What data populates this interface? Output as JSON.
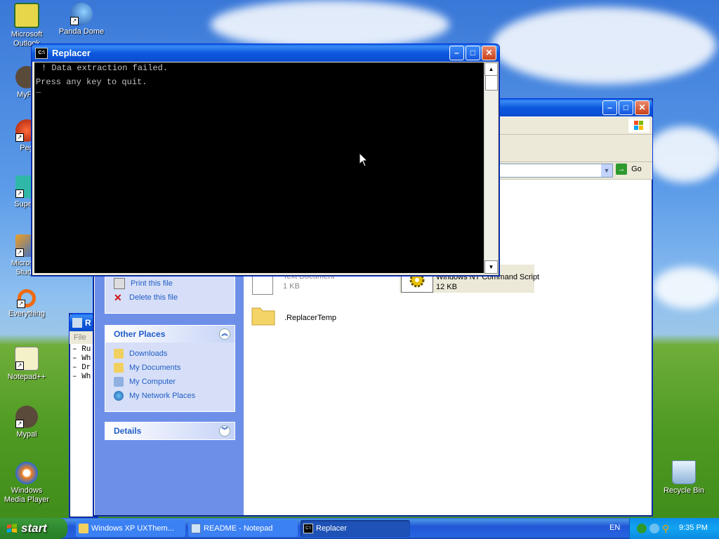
{
  "desktop": {
    "icons": [
      {
        "label": "Microsoft Outlook",
        "name": "outlook"
      },
      {
        "label": "Panda Dome",
        "name": "panda-dome"
      },
      {
        "label": "MyPa",
        "name": "mypal-partial"
      },
      {
        "label": "Peg",
        "name": "peg-partial"
      },
      {
        "label": "Supern",
        "name": "supern-partial"
      },
      {
        "label": "Microsoft Studio",
        "name": "ms-studio-partial"
      },
      {
        "label": "Everything",
        "name": "everything"
      },
      {
        "label": "Notepad++",
        "name": "notepadpp"
      },
      {
        "label": "Mypal",
        "name": "mypal"
      },
      {
        "label": "Windows Media Player",
        "name": "wmp"
      },
      {
        "label": "Recycle Bin",
        "name": "recycle-bin"
      }
    ]
  },
  "console_window": {
    "title": "Replacer",
    "title_icon": "C:\\",
    "lines": [
      "! Data extraction failed.",
      "Press any key to quit.",
      "_"
    ]
  },
  "explorer": {
    "go_label": "Go",
    "file_tasks": [
      {
        "label": "Print this file",
        "icon": "printer-icon"
      },
      {
        "label": "Delete this file",
        "icon": "delete-x-icon"
      }
    ],
    "other_places": {
      "title": "Other Places",
      "items": [
        "Downloads",
        "My Documents",
        "My Computer",
        "My Network Places"
      ]
    },
    "details": {
      "title": "Details"
    },
    "files": [
      {
        "name": "",
        "type": "Text Document",
        "size": "1 KB"
      },
      {
        "name": "",
        "type": "Windows NT Command Script",
        "size": "12 KB"
      },
      {
        "name": ".ReplacerTemp",
        "type": "",
        "size": ""
      }
    ]
  },
  "notepad_partial": {
    "title": "R",
    "menu": "File",
    "lines": [
      "Ru",
      "Wh",
      "Dr",
      "Wh"
    ]
  },
  "taskbar": {
    "start_label": "start",
    "items": [
      {
        "label": "Windows XP UXThem...",
        "icon": "folder-icon"
      },
      {
        "label": "README - Notepad",
        "icon": "notepad-icon"
      },
      {
        "label": "Replacer",
        "icon": "console-icon"
      }
    ],
    "language": "EN",
    "clock": "9:35 PM"
  },
  "colors": {
    "titlebar_blue": "#0a5fe6",
    "taskpane_blue": "#6d8fe8",
    "link_blue": "#215dc6",
    "start_green": "#3c9a3c"
  }
}
